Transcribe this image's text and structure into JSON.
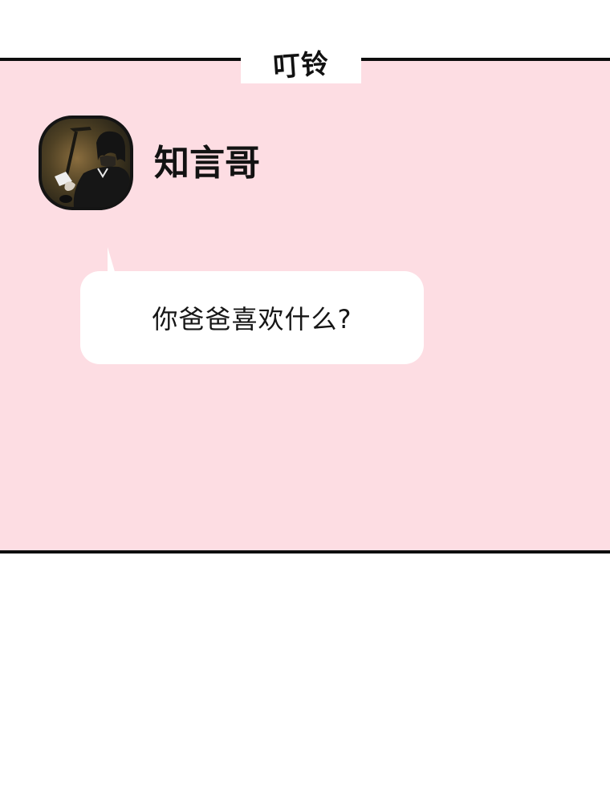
{
  "header": {
    "title": "叮铃"
  },
  "contact": {
    "name": "知言哥",
    "avatar_icon": "profile-avatar"
  },
  "messages": [
    {
      "text": "你爸爸喜欢什么?"
    }
  ],
  "colors": {
    "panel_background": "#fddde3",
    "border": "#0d0d0d",
    "bubble": "#ffffff",
    "text": "#121212"
  }
}
